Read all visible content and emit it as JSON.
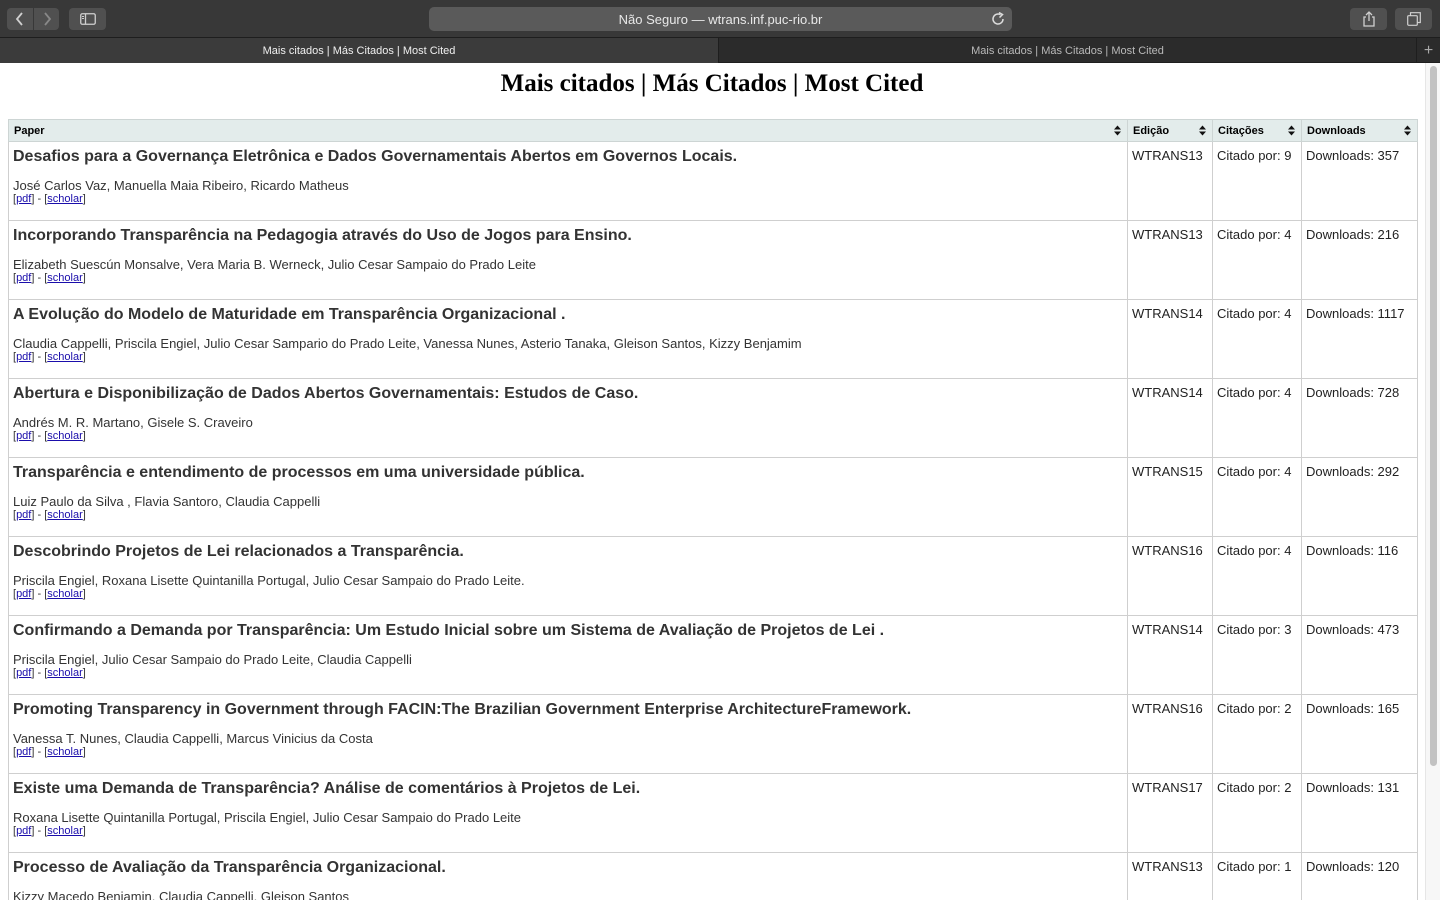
{
  "browser": {
    "url_text": "Não Seguro — wtrans.inf.puc-rio.br",
    "tabs": [
      {
        "label": "Mais citados | Más Citados | Most Cited",
        "active": true
      },
      {
        "label": "Mais citados | Más Citados | Most Cited",
        "active": false
      }
    ],
    "icons": [
      "back-icon",
      "forward-icon",
      "sidebar-icon",
      "reload-icon",
      "share-icon",
      "tabs-overview-icon",
      "new-tab-icon"
    ]
  },
  "page": {
    "title": "Mais citados | Más Citados | Most Cited",
    "columns": [
      "Paper",
      "Edição",
      "Citações",
      "Downloads"
    ],
    "link_pdf": "pdf",
    "link_scholar": "scholar",
    "link_separator": " - ",
    "rows": [
      {
        "title": "Desafios para a Governança Eletrônica e Dados Governamentais Abertos em Governos Locais.",
        "authors": "José Carlos Vaz, Manuella Maia Ribeiro, Ricardo Matheus",
        "edition": "WTRANS13",
        "citations": "Citado por: 9",
        "downloads": "Downloads: 357"
      },
      {
        "title": "Incorporando Transparência na Pedagogia através do Uso de Jogos para Ensino.",
        "authors": "Elizabeth Suescún Monsalve, Vera Maria B. Werneck, Julio Cesar Sampaio do Prado Leite",
        "edition": "WTRANS13",
        "citations": "Citado por: 4",
        "downloads": "Downloads: 216"
      },
      {
        "title": "A Evolução do Modelo de Maturidade em Transparência Organizacional .",
        "authors": "Claudia Cappelli, Priscila Engiel, Julio Cesar Sampario do Prado Leite, Vanessa Nunes, Asterio Tanaka, Gleison Santos, Kizzy Benjamim",
        "edition": "WTRANS14",
        "citations": "Citado por: 4",
        "downloads": "Downloads: 1117"
      },
      {
        "title": "Abertura e Disponibilização de Dados Abertos Governamentais: Estudos de Caso.",
        "authors": "Andrés M. R. Martano, Gisele S. Craveiro",
        "edition": "WTRANS14",
        "citations": "Citado por: 4",
        "downloads": "Downloads: 728"
      },
      {
        "title": "Transparência e entendimento de processos em uma universidade pública.",
        "authors": "Luiz Paulo da Silva , Flavia Santoro, Claudia Cappelli",
        "edition": "WTRANS15",
        "citations": "Citado por: 4",
        "downloads": "Downloads: 292"
      },
      {
        "title": "Descobrindo Projetos de Lei relacionados a Transparência.",
        "authors": "Priscila Engiel, Roxana Lisette Quintanilla Portugal, Julio Cesar Sampaio do Prado Leite.",
        "edition": "WTRANS16",
        "citations": "Citado por: 4",
        "downloads": "Downloads: 116"
      },
      {
        "title": "Confirmando a Demanda por Transparência: Um Estudo Inicial sobre um Sistema de Avaliação de Projetos de Lei .",
        "authors": "Priscila Engiel, Julio Cesar Sampaio do Prado Leite, Claudia Cappelli",
        "edition": "WTRANS14",
        "citations": "Citado por: 3",
        "downloads": "Downloads: 473"
      },
      {
        "title": "Promoting Transparency in Government through FACIN:The Brazilian Government Enterprise ArchitectureFramework.",
        "authors": "Vanessa T. Nunes, Claudia Cappelli, Marcus Vinicius da Costa",
        "edition": "WTRANS16",
        "citations": "Citado por: 2",
        "downloads": "Downloads: 165"
      },
      {
        "title": "Existe uma Demanda de Transparência? Análise de comentários à Projetos de Lei.",
        "authors": "Roxana Lisette Quintanilla Portugal, Priscila Engiel, Julio Cesar Sampaio do Prado Leite",
        "edition": "WTRANS17",
        "citations": "Citado por: 2",
        "downloads": "Downloads: 131"
      },
      {
        "title": "Processo de Avaliação da Transparência Organizacional.",
        "authors": "Kizzy Macedo Benjamin, Claudia Cappelli, Gleison Santos",
        "edition": "WTRANS13",
        "citations": "Citado por: 1",
        "downloads": "Downloads: 120"
      }
    ]
  }
}
